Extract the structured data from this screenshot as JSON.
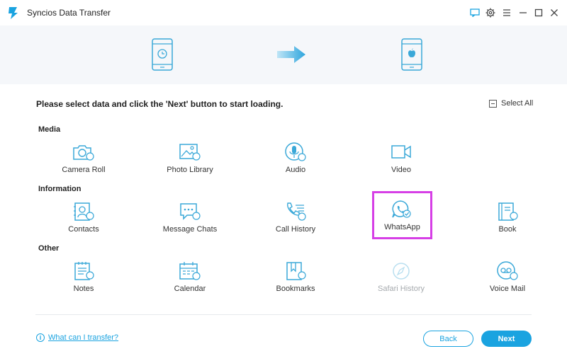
{
  "app": {
    "title": "Syncios Data Transfer"
  },
  "window_controls": [
    "feedback-icon",
    "settings-icon",
    "menu-icon",
    "minimize-icon",
    "maximize-icon",
    "close-icon"
  ],
  "instruction": "Please select data and click the 'Next' button to start loading.",
  "select_all": "Select All",
  "sections": {
    "media": {
      "title": "Media",
      "items": [
        {
          "label": "Camera Roll",
          "icon": "camera-icon"
        },
        {
          "label": "Photo Library",
          "icon": "photo-icon"
        },
        {
          "label": "Audio",
          "icon": "microphone-icon"
        },
        {
          "label": "Video",
          "icon": "video-camera-icon"
        }
      ]
    },
    "information": {
      "title": "Information",
      "items": [
        {
          "label": "Contacts",
          "icon": "contacts-icon"
        },
        {
          "label": "Message Chats",
          "icon": "chat-bubble-icon"
        },
        {
          "label": "Call History",
          "icon": "phone-list-icon"
        },
        {
          "label": "WhatsApp",
          "icon": "whatsapp-icon",
          "selected": true
        },
        {
          "label": "Book",
          "icon": "book-icon"
        }
      ]
    },
    "other": {
      "title": "Other",
      "items": [
        {
          "label": "Notes",
          "icon": "notes-icon"
        },
        {
          "label": "Calendar",
          "icon": "calendar-icon"
        },
        {
          "label": "Bookmarks",
          "icon": "bookmark-icon"
        },
        {
          "label": "Safari History",
          "icon": "compass-icon",
          "disabled": true
        },
        {
          "label": "Voice Mail",
          "icon": "voicemail-icon"
        }
      ]
    }
  },
  "help_link": "What can I transfer?",
  "buttons": {
    "back": "Back",
    "next": "Next"
  },
  "colors": {
    "accent": "#1aa3e0",
    "icon": "#3aa8d8",
    "highlight": "#d63fe6",
    "banner": "#f5f7fa"
  }
}
